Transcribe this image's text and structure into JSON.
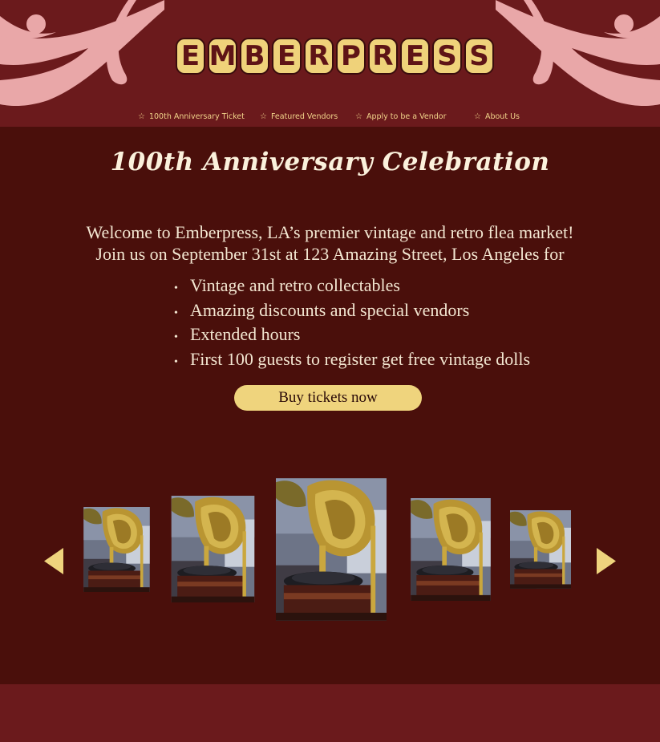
{
  "brand": {
    "letters": [
      "E",
      "M",
      "B",
      "E",
      "R",
      "P",
      "R",
      "E",
      "S",
      "S"
    ]
  },
  "nav": {
    "items": [
      {
        "label": "100th Anniversary Ticket",
        "icon": "star-outline-icon"
      },
      {
        "label": "Featured Vendors",
        "icon": "star-outline-icon"
      },
      {
        "label": "Apply to be a Vendor",
        "icon": "star-outline-icon"
      },
      {
        "label": "About Us",
        "icon": "star-outline-icon"
      }
    ]
  },
  "hero": {
    "title": "100th Anniversary Celebration",
    "intro_line1": "Welcome to Emberpress, LA’s premier vintage and retro flea market!",
    "intro_line2": "Join us on September 31st  at 123 Amazing Street, Los Angeles for",
    "features": [
      "Vintage and retro collectables",
      "Amazing discounts and special vendors",
      "Extended hours",
      "First 100 guests to register get free vintage dolls"
    ],
    "cta_label": "Buy tickets now"
  },
  "carousel": {
    "prev_icon": "arrow-left-icon",
    "next_icon": "arrow-right-icon",
    "images": [
      "gramophone-photo",
      "gramophone-photo",
      "gramophone-photo",
      "gramophone-photo",
      "gramophone-photo"
    ]
  },
  "colors": {
    "header_bg": "#6b1a1c",
    "main_bg": "#4a0f0b",
    "accent_gold": "#efd47d",
    "swirl_pink": "#e9a7a8",
    "text_cream": "#f3e6d1"
  }
}
